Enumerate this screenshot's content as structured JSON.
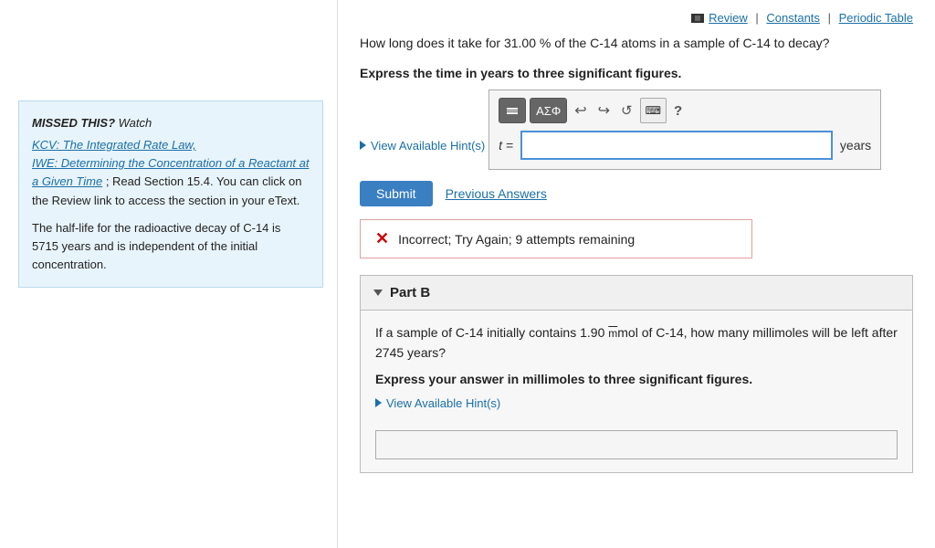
{
  "topLinks": {
    "reviewLabel": "Review",
    "separator1": "|",
    "constantsLabel": "Constants",
    "separator2": "|",
    "periodicTableLabel": "Periodic Table"
  },
  "questionA": {
    "text": "How long does it take for 31.00 % of the C-14 atoms in a sample of C-14 to decay?",
    "instruction": "Express the time in years to three significant figures.",
    "hintLabel": "View Available Hint(s)",
    "mathLabel": "t =",
    "unit": "years",
    "submitLabel": "Submit",
    "previousAnswersLabel": "Previous Answers",
    "errorMessage": "Incorrect; Try Again; 9 attempts remaining"
  },
  "sidebar": {
    "missedTitle": "MISSED THIS?",
    "watchLabel": "Watch",
    "link1": "KCV: The Integrated Rate Law,",
    "link2": "IWE: Determining the Concentration of a Reactant at a Given Time",
    "note": "; Read Section 15.4. You can click on the Review link to access the section in your eText.",
    "halfLife": "The half-life for the radioactive decay of C-14 is 5715 years and is independent of the initial concentration."
  },
  "partB": {
    "title": "Part B",
    "question": "If a sample of C-14 initially contains 1.90 mmol of C-14, how many millimoles will be left after 2745 years?",
    "instruction": "Express your answer in millimoles to three significant figures.",
    "hintLabel": "View Available Hint(s)"
  }
}
